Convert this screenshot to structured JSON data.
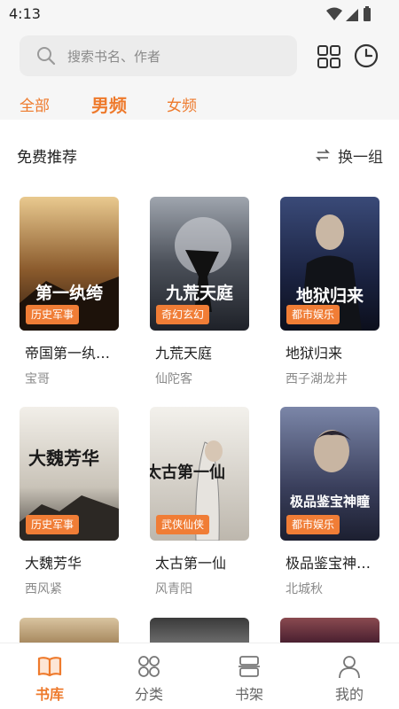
{
  "status": {
    "time": "4:13"
  },
  "search": {
    "placeholder": "搜索书名、作者"
  },
  "tabs": [
    {
      "label": "全部"
    },
    {
      "label": "男频"
    },
    {
      "label": "女频"
    }
  ],
  "section": {
    "title": "免费推荐",
    "swap_label": "换一组"
  },
  "books": [
    {
      "title": "帝国第一纨…",
      "author": "宝哥",
      "category": "历史军事",
      "cover_text": "第一纨绔"
    },
    {
      "title": "九荒天庭",
      "author": "仙陀客",
      "category": "奇幻玄幻",
      "cover_text": "九荒天庭"
    },
    {
      "title": "地狱归来",
      "author": "西子湖龙井",
      "category": "都市娱乐",
      "cover_text": "地狱归来"
    },
    {
      "title": "大魏芳华",
      "author": "西风紧",
      "category": "历史军事",
      "cover_text": "大魏芳华"
    },
    {
      "title": "太古第一仙",
      "author": "风青阳",
      "category": "武侠仙侠",
      "cover_text": "太古第一仙"
    },
    {
      "title": "极品鉴宝神…",
      "author": "北城秋",
      "category": "都市娱乐",
      "cover_text": "极品鉴宝神瞳"
    }
  ],
  "nav": [
    {
      "label": "书库"
    },
    {
      "label": "分类"
    },
    {
      "label": "书架"
    },
    {
      "label": "我的"
    }
  ],
  "colors": {
    "accent": "#ee7a2c",
    "badge": "#f07d36"
  }
}
